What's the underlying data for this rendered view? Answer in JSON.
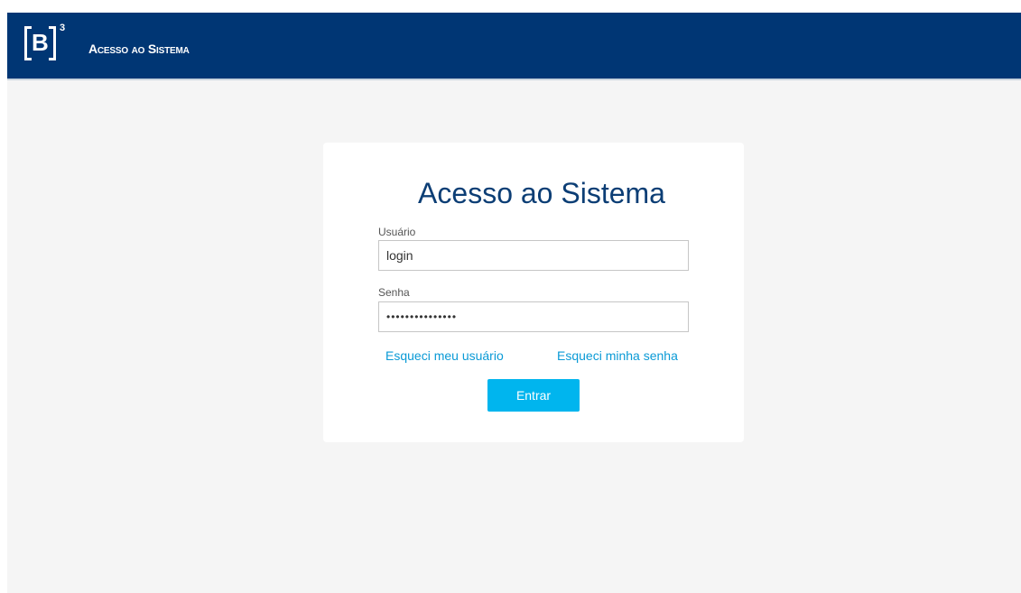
{
  "header": {
    "logo": {
      "letter": "B",
      "superscript": "3"
    },
    "title": "Acesso ao Sistema"
  },
  "login": {
    "title": "Acesso ao Sistema",
    "username": {
      "label": "Usuário",
      "value": "login"
    },
    "password": {
      "label": "Senha",
      "value": "•••••••••••••••"
    },
    "forgot_user": "Esqueci meu usuário",
    "forgot_password": "Esqueci minha senha",
    "submit": "Entrar"
  },
  "colors": {
    "header_bg": "#003674",
    "page_bg": "#f5f5f5",
    "title": "#0c3e75",
    "link": "#0a9ad6",
    "button": "#00b5ee"
  }
}
